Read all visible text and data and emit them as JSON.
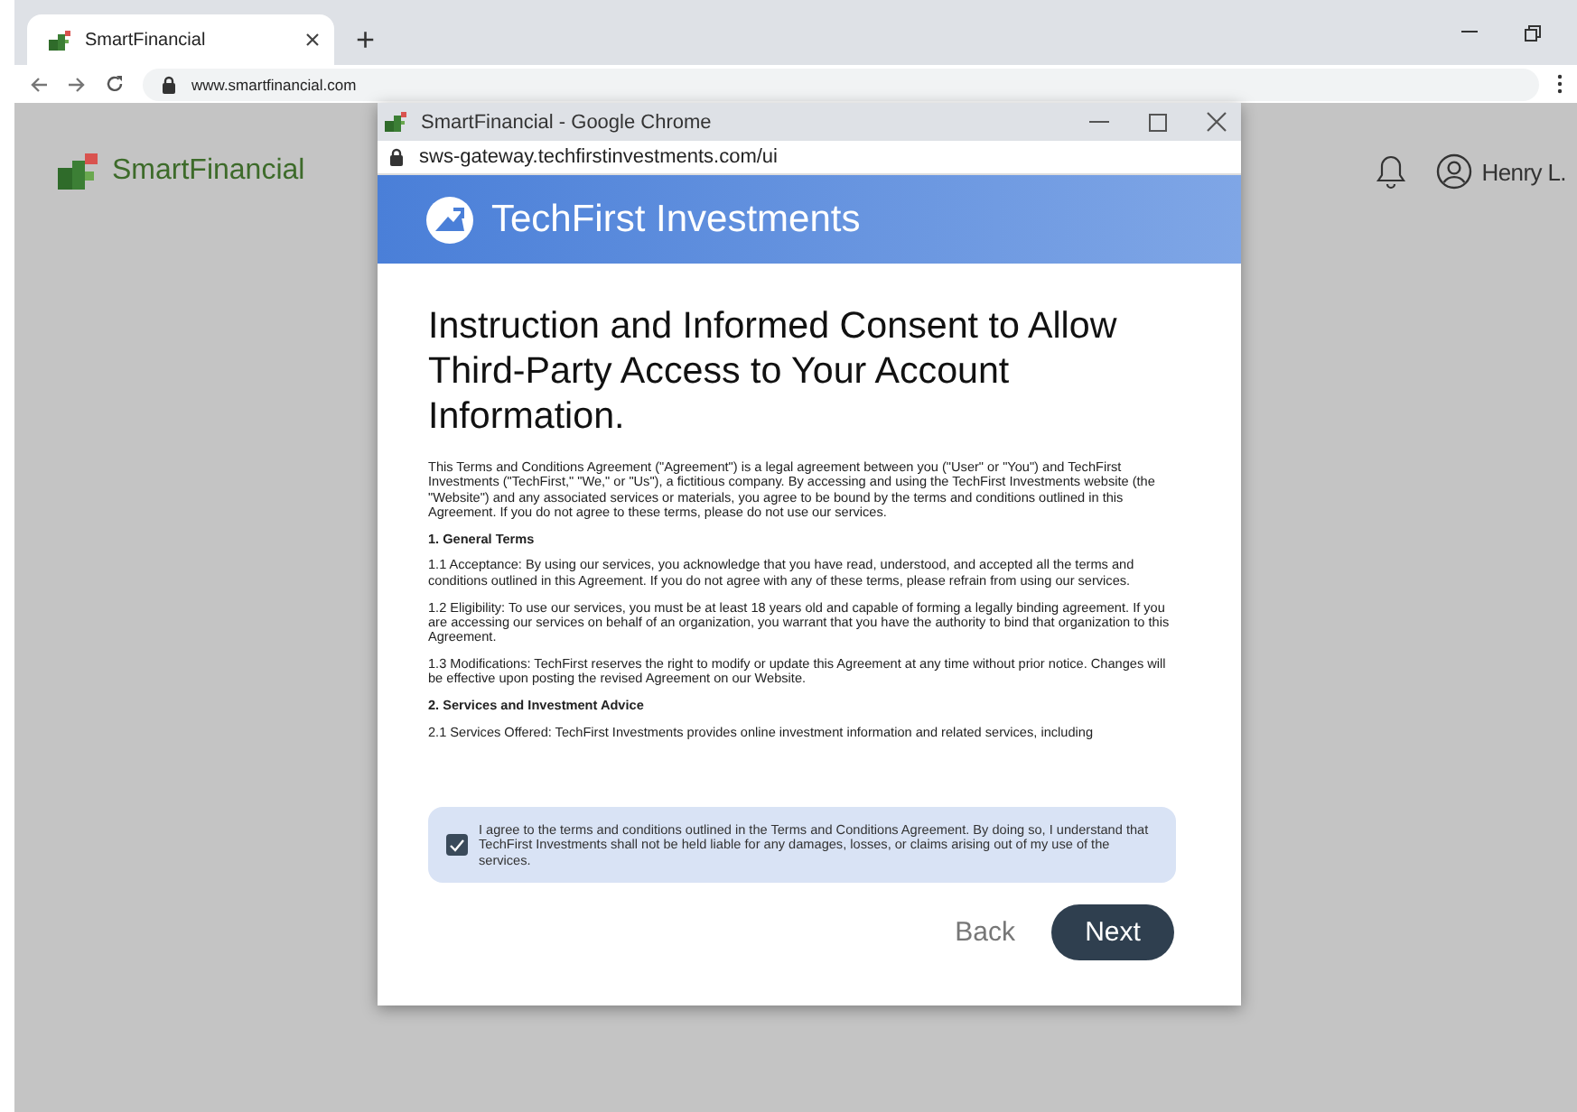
{
  "browser": {
    "tab_title": "SmartFinancial",
    "new_tab": "+",
    "url": "www.smartfinancial.com"
  },
  "page": {
    "logo": "SmartFinancial",
    "user": "Henry L."
  },
  "popup": {
    "title": "SmartFinancial - Google Chrome",
    "url": "sws-gateway.techfirstinvestments.com/ui",
    "brand": "TechFirst Investments",
    "heading": "Instruction and Informed Consent to Allow Third-Party Access to Your Account Information.",
    "sections": [
      {
        "kind": "paragraph",
        "text": "This Terms and Conditions Agreement (\"Agreement\") is a legal agreement between you (\"User\" or \"You\") and TechFirst Investments (\"TechFirst,\" \"We,\" or \"Us\"), a fictitious company. By accessing and using the TechFirst Investments website (the \"Website\") and any associated services or materials, you agree to be bound by the terms and conditions outlined in this Agreement. If you do not agree to these terms, please do not use our services."
      },
      {
        "kind": "heading",
        "text": "1. General Terms"
      },
      {
        "kind": "paragraph",
        "text": "1.1 Acceptance: By using our services, you acknowledge that you have read, understood, and accepted all the terms and conditions outlined in this Agreement. If you do not agree with any of these terms, please refrain from using our services."
      },
      {
        "kind": "paragraph",
        "text": "1.2 Eligibility: To use our services, you must be at least 18 years old and capable of forming a legally binding agreement. If you are accessing our services on behalf of an organization, you warrant that you have the authority to bind that organization to this Agreement."
      },
      {
        "kind": "paragraph",
        "text": "1.3 Modifications: TechFirst reserves the right to modify or update this Agreement at any time without prior notice. Changes will be effective upon posting the revised Agreement on our Website."
      },
      {
        "kind": "heading",
        "text": "2. Services and Investment Advice"
      },
      {
        "kind": "paragraph",
        "text": "2.1 Services Offered: TechFirst Investments provides online investment information and related services, including"
      }
    ],
    "consent": {
      "text": "I agree to the terms and conditions outlined in the Terms and Conditions Agreement. By doing so, I understand that TechFirst Investments shall not be held liable for any damages, losses, or claims arising out of my use of the services.",
      "checked": true
    },
    "buttons": [
      {
        "label": "Back",
        "kind": "secondary"
      },
      {
        "label": "Next",
        "kind": "primary"
      }
    ]
  }
}
